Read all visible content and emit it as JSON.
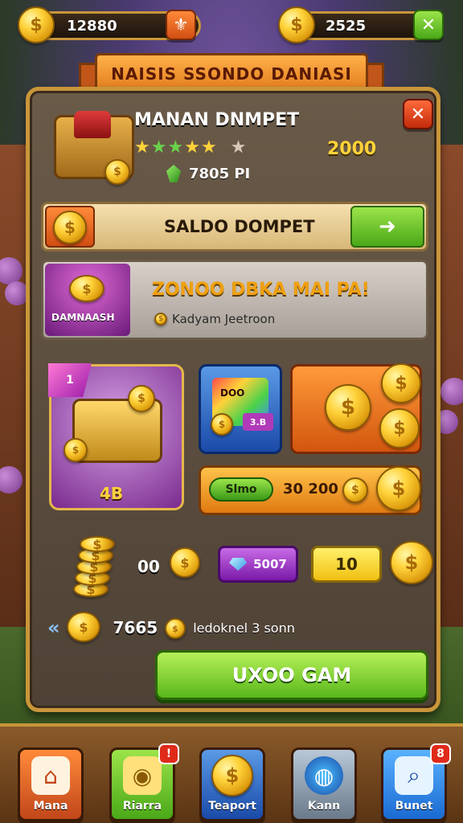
{
  "top_bar": {
    "coins_value": "12880",
    "gems_value": "2525",
    "left_button_icon": "fleur-icon",
    "right_button_icon": "close-icon"
  },
  "banner": {
    "title": "NAISIS SSONDO DANIASI"
  },
  "item": {
    "name": "MANAN DNMPET",
    "price": "2000",
    "gems": "7805 PI",
    "stars_filled": 4,
    "stars_total": 5
  },
  "saldo": {
    "label": "SALDO DOMPET",
    "go_icon": "arrow-icon"
  },
  "promo": {
    "title": "ZONOO DBKA MAI PA!",
    "subtitle": "DAMNAASH",
    "desc": "Kadyam Jeetroon"
  },
  "bundle": {
    "badge": "1",
    "value": "4B"
  },
  "card_blue": {
    "label": "DOO",
    "tag": "3.B"
  },
  "sale": {
    "pill": "Slmo",
    "text": "30 200"
  },
  "coins_row": {
    "qty": "00",
    "gem_label": "5007",
    "count": "10"
  },
  "transfer": {
    "amount": "7665",
    "desc": "ledoknel 3 sonn"
  },
  "cta": {
    "label": "UXOO GAM"
  },
  "nav": [
    {
      "label": "Mana",
      "icon": "home-icon",
      "badge": ""
    },
    {
      "label": "Riarra",
      "icon": "bag-icon",
      "badge": "!"
    },
    {
      "label": "Teaport",
      "icon": "coin-icon",
      "badge": ""
    },
    {
      "label": "Kann",
      "icon": "globe-icon",
      "badge": ""
    },
    {
      "label": "Bunet",
      "icon": "search-icon",
      "badge": "8"
    }
  ],
  "colors": {
    "accent_gold": "#c9963a",
    "cta_green": "#5ab81a",
    "banner_orange": "#e07a1a"
  }
}
